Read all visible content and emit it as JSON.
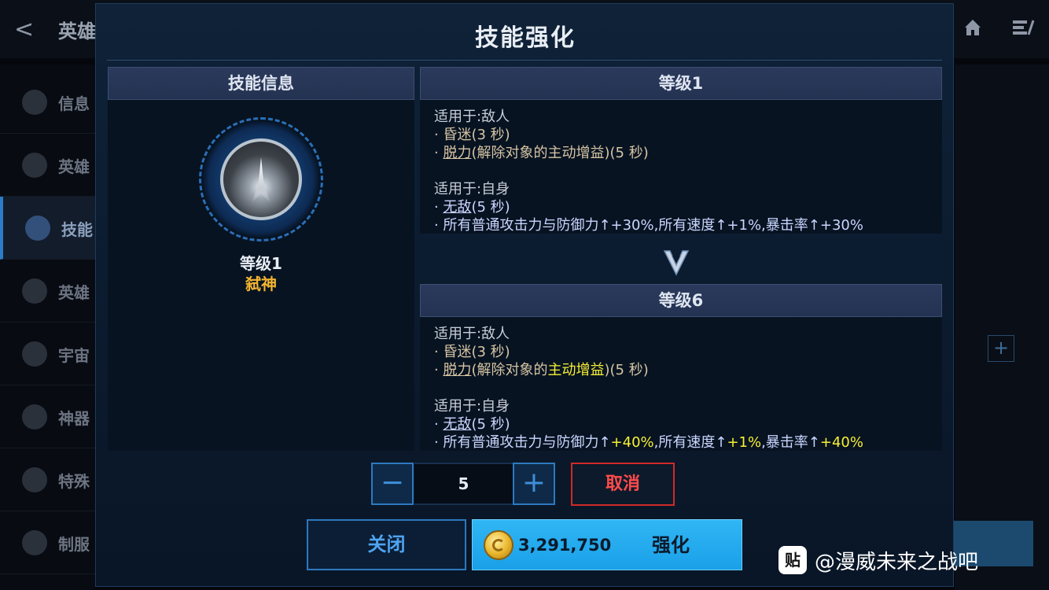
{
  "background": {
    "back_glyph": "<",
    "title": "英雄",
    "sidebar": [
      {
        "label": "信息"
      },
      {
        "label": "英雄"
      },
      {
        "label": "技能",
        "active": true
      },
      {
        "label": "英雄"
      },
      {
        "label": "宇宙"
      },
      {
        "label": "神器"
      },
      {
        "label": "特殊"
      },
      {
        "label": "制服"
      }
    ],
    "right_plus": "+"
  },
  "modal": {
    "title": "技能强化",
    "left_panel": {
      "header": "技能信息",
      "level": "等级1",
      "skill_name": "弑神",
      "icon": "skill-burst-icon"
    },
    "current": {
      "header": "等级1",
      "enemy_label": "适用于:敌人",
      "stun": "· 昏迷(3 秒)",
      "drain_prefix": "· ",
      "drain_name": "脱力",
      "drain_mid": "(解除对象的主动增益)(5 秒)",
      "self_label": "适用于:自身",
      "invinc_prefix": "· ",
      "invinc_name": "无敌",
      "invinc_dur": "(5 秒)",
      "stats": "· 所有普通攻击力与防御力↑+30%,所有速度↑+1%,暴击率↑+30%"
    },
    "next": {
      "header": "等级6",
      "enemy_label": "适用于:敌人",
      "stun": "· 昏迷(3 秒)",
      "drain_prefix": "· ",
      "drain_name": "脱力",
      "drain_mid1": "(解除对象的",
      "drain_highlight": "主动增益",
      "drain_mid2": ")(5 秒)",
      "self_label": "适用于:自身",
      "invinc_prefix": "· ",
      "invinc_name": "无敌",
      "invinc_dur": "(5 秒)",
      "stats_a": "· 所有普通攻击力与防御力↑",
      "stats_a_val": "+40%",
      "stats_b": ",所有速度↑",
      "stats_b_val": "+1%",
      "stats_c": ",暴击率↑",
      "stats_c_val": "+40%"
    },
    "stepper": {
      "minus": "−",
      "value": "5",
      "plus": "+"
    },
    "cancel_label": "取消",
    "close_label": "关闭",
    "upgrade": {
      "cost": "3,291,750",
      "label": "强化",
      "coin_icon": "gold-coin-icon"
    }
  },
  "watermark": {
    "icon": "贴",
    "text": "@漫威未来之战吧"
  },
  "colors": {
    "accent_blue": "#2d79c0",
    "cancel_red": "#d02a2a",
    "highlight_yellow": "#f7f034",
    "skill_name_gold": "#f2b431",
    "upgrade_bg": "#1ea8ee"
  }
}
